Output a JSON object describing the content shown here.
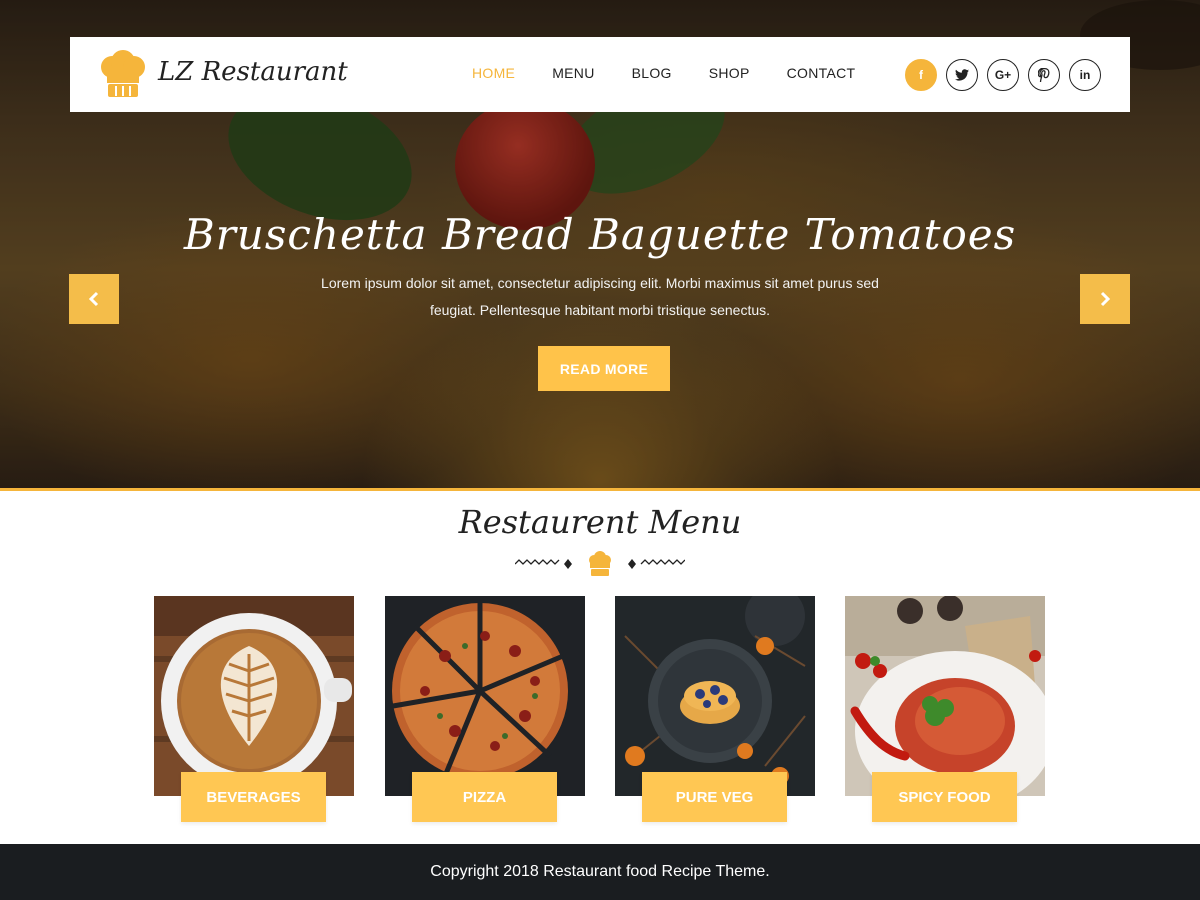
{
  "header": {
    "logo_text": "LZ Restaurant",
    "nav": [
      {
        "label": "HOME",
        "active": true
      },
      {
        "label": "MENU"
      },
      {
        "label": "BLOG"
      },
      {
        "label": "SHOP"
      },
      {
        "label": "CONTACT"
      }
    ],
    "social": [
      {
        "icon": "facebook-icon",
        "glyph": "f"
      },
      {
        "icon": "twitter-icon",
        "glyph": "t"
      },
      {
        "icon": "google-plus-icon",
        "glyph": "G+"
      },
      {
        "icon": "pinterest-icon",
        "glyph": "p"
      },
      {
        "icon": "linkedin-icon",
        "glyph": "in"
      }
    ]
  },
  "slider": {
    "title": "Bruschetta Bread Baguette Tomatoes",
    "text": "Lorem ipsum dolor sit amet, consectetur adipiscing elit. Morbi maximus sit amet purus sed feugiat. Pellentesque habitant morbi tristique senectus.",
    "button": "READ MORE"
  },
  "menu_section": {
    "title": "Restaurent Menu",
    "items": [
      {
        "label": "BEVERAGES"
      },
      {
        "label": "PIZZA"
      },
      {
        "label": "PURE VEG"
      },
      {
        "label": "SPICY FOOD"
      }
    ]
  },
  "footer": {
    "copyright": "Copyright 2018 Restaurant food Recipe Theme."
  },
  "colors": {
    "accent": "#f5b53b",
    "button": "#ffc753",
    "footer_bg": "#1a1d20"
  }
}
